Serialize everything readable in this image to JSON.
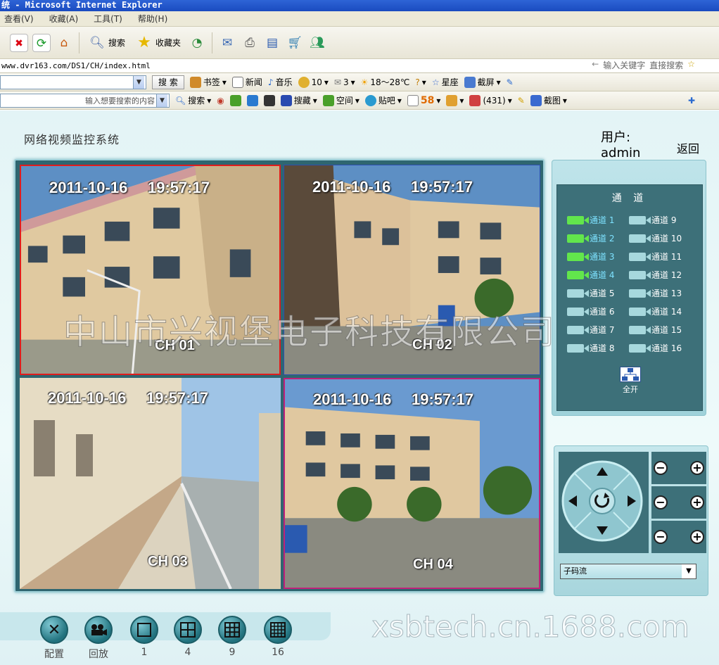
{
  "window": {
    "title": "统 - Microsoft Internet Explorer"
  },
  "menu": [
    "查看(V)",
    "收藏(A)",
    "工具(T)",
    "帮助(H)"
  ],
  "toolbar": {
    "search_label": "搜索",
    "favorites_label": "收藏夹"
  },
  "address": {
    "url": "www.dvr163.com/DS1/CH/index.html",
    "hint": "输入关键字",
    "direct_search": "直接搜索"
  },
  "bar1": {
    "search_button": "搜 索",
    "items": [
      "书签",
      "新闻",
      "音乐",
      "10",
      "3",
      "18～28℃",
      "星座",
      "截屏"
    ]
  },
  "bar2": {
    "search_placeholder": "输入想要搜索的内容",
    "items": [
      "搜索",
      "搜藏",
      "空间",
      "贴吧",
      "58",
      "(431)",
      "截图"
    ]
  },
  "app": {
    "title": "网络视频监控系统",
    "user_label": "用户: admin",
    "back_label": "返回"
  },
  "cameras": [
    {
      "date": "2011-10-16",
      "time": "19:57:17",
      "channel": "CH 01"
    },
    {
      "date": "2011-10-16",
      "time": "19:57:17",
      "channel": "CH 02"
    },
    {
      "date": "2011-10-16",
      "time": "19:57:17",
      "channel": "CH 03"
    },
    {
      "date": "2011-10-16",
      "time": "19:57:17",
      "channel": "CH 04"
    }
  ],
  "channels": {
    "title": "通 道",
    "items": [
      {
        "label": "通道 1",
        "live": true
      },
      {
        "label": "通道 2",
        "live": true
      },
      {
        "label": "通道 3",
        "live": true
      },
      {
        "label": "通道 4",
        "live": true
      },
      {
        "label": "通道 5",
        "live": false
      },
      {
        "label": "通道 6",
        "live": false
      },
      {
        "label": "通道 7",
        "live": false
      },
      {
        "label": "通道 8",
        "live": false
      },
      {
        "label": "通道 9",
        "live": false
      },
      {
        "label": "通道 10",
        "live": false
      },
      {
        "label": "通道 11",
        "live": false
      },
      {
        "label": "通道 12",
        "live": false
      },
      {
        "label": "通道 13",
        "live": false
      },
      {
        "label": "通道 14",
        "live": false
      },
      {
        "label": "通道 15",
        "live": false
      },
      {
        "label": "通道 16",
        "live": false
      }
    ],
    "open_all": "全开"
  },
  "ptz": {
    "stream_selected": "子码流"
  },
  "bottom": [
    "配置",
    "回放",
    "1",
    "4",
    "9",
    "16"
  ],
  "watermarks": {
    "company": "中山市兴视堡电子科技有限公司",
    "site": "xsbtech.cn.1688.com"
  },
  "colors": {
    "accent": "#3d7079",
    "live_channel": "#7ee2ff",
    "live_icon": "#62e64c"
  }
}
